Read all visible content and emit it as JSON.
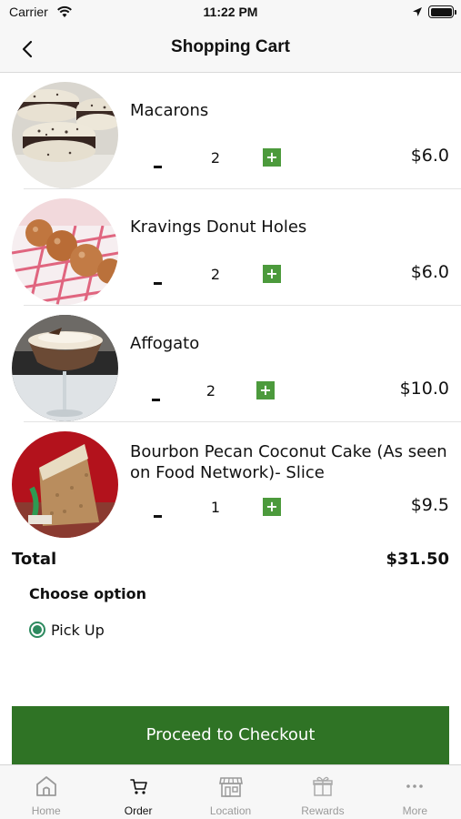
{
  "status": {
    "carrier": "Carrier",
    "time": "11:22 PM"
  },
  "nav": {
    "title": "Shopping Cart"
  },
  "items": [
    {
      "name": "Macarons",
      "qty": "2",
      "price": "$6.0",
      "minus": "-",
      "plus": "+"
    },
    {
      "name": "Kravings Donut Holes",
      "qty": "2",
      "price": "$6.0",
      "minus": "-",
      "plus": "+"
    },
    {
      "name": "Affogato",
      "qty": "2",
      "price": "$10.0",
      "minus": "-",
      "plus": "+"
    },
    {
      "name": "Bourbon Pecan Coconut Cake (As seen on Food Network)- Slice",
      "qty": "1",
      "price": "$9.5",
      "minus": "-",
      "plus": "+"
    }
  ],
  "total": {
    "label": "Total",
    "value": "$31.50"
  },
  "options": {
    "heading": "Choose option",
    "pickup": "Pick Up"
  },
  "checkout": {
    "label": "Proceed to Checkout"
  },
  "tabs": [
    {
      "label": "Home",
      "icon": "home-icon"
    },
    {
      "label": "Order",
      "icon": "cart-icon"
    },
    {
      "label": "Location",
      "icon": "store-icon"
    },
    {
      "label": "Rewards",
      "icon": "gift-icon"
    },
    {
      "label": "More",
      "icon": "more-icon"
    }
  ],
  "colors": {
    "accent_green": "#4c9a3c",
    "checkout_green": "#2f7325",
    "radio_teal": "#2d8a5f"
  }
}
